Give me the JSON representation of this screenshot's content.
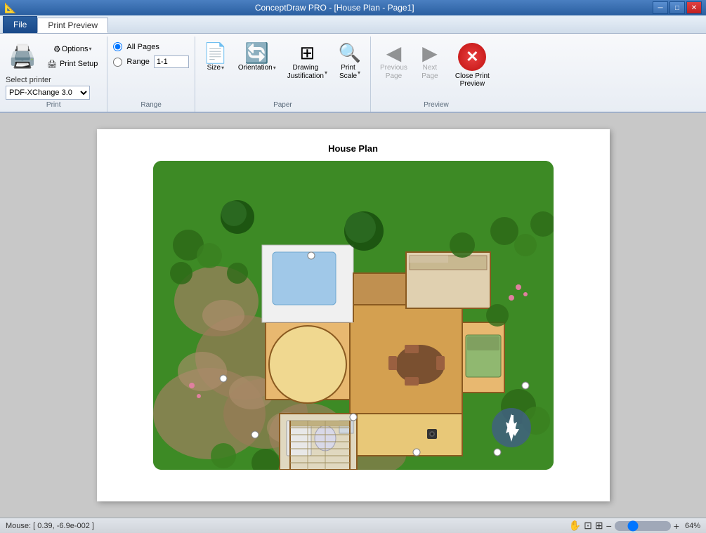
{
  "titlebar": {
    "title": "ConceptDraw PRO - [House Plan - Page1]",
    "minimize": "─",
    "maximize": "□",
    "close": "✕"
  },
  "tabs": {
    "file": "File",
    "print_preview": "Print Preview"
  },
  "ribbon": {
    "print_group": {
      "label": "Print",
      "print_btn": "Print",
      "options_btn": "Options",
      "setup_btn": "Print Setup"
    },
    "range_group": {
      "label": "Range",
      "all_pages": "All Pages",
      "range": "Range",
      "range_value": "1-1"
    },
    "paper_group": {
      "label": "Paper",
      "size_btn": "Size",
      "orientation_btn": "Orientation",
      "drawing_justification_btn": "Drawing\nJustification",
      "print_scale_btn": "Print\nScale"
    },
    "preview_group": {
      "label": "Preview",
      "previous_page_btn": "Previous\nPage",
      "next_page_btn": "Next\nPage",
      "close_print_btn": "Close Print\nPreview"
    }
  },
  "page": {
    "title": "House Plan"
  },
  "statusbar": {
    "mouse": "Mouse: [ 0.39, -6.9e-002 ]",
    "zoom": "64%"
  }
}
